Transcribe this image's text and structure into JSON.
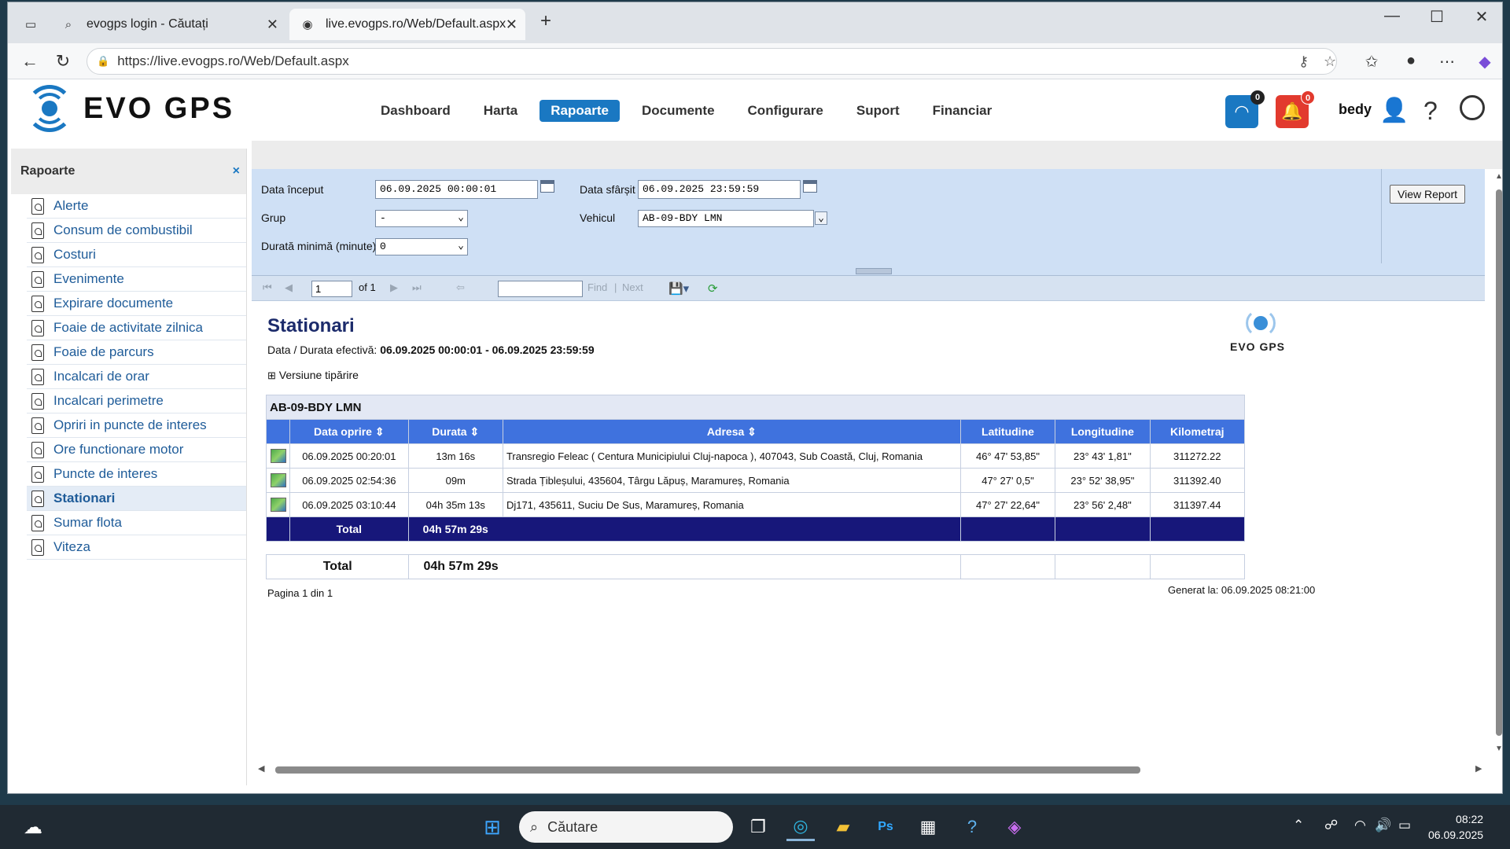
{
  "browser": {
    "tabs": [
      {
        "title": "evogps login - Căutați",
        "icon": "search-icon"
      },
      {
        "title": "live.evogps.ro/Web/Default.aspx",
        "icon": "evogps-favicon"
      }
    ],
    "url": "https://live.evogps.ro/Web/Default.aspx"
  },
  "app": {
    "logo_text": "EVO GPS",
    "menu": [
      "Dashboard",
      "Harta",
      "Rapoarte",
      "Documente",
      "Configurare",
      "Suport",
      "Financiar"
    ],
    "active_menu": "Rapoarte",
    "feed_badge": "0",
    "alert_badge": "0",
    "user": "bedy",
    "help_label": "?"
  },
  "sidebar": {
    "title": "Rapoarte",
    "close_label": "×",
    "items": [
      "Alerte",
      "Consum de combustibil",
      "Costuri",
      "Evenimente",
      "Expirare documente",
      "Foaie de activitate zilnica",
      "Foaie de parcurs",
      "Incalcari de orar",
      "Incalcari perimetre",
      "Opriri in puncte de interes",
      "Ore functionare motor",
      "Puncte de interes",
      "Stationari",
      "Sumar flota",
      "Viteza"
    ],
    "active_item": "Stationari"
  },
  "params": {
    "start_label": "Data început",
    "start_value": "06.09.2025 00:00:01",
    "end_label": "Data sfârșit",
    "end_value": "06.09.2025 23:59:59",
    "group_label": "Grup",
    "group_value": "-",
    "vehicle_label": "Vehicul",
    "vehicle_value": "AB-09-BDY LMN",
    "min_duration_label": "Durată minimă (minute)",
    "min_duration_value": "0",
    "view_report": "View Report"
  },
  "toolbar": {
    "page_value": "1",
    "of_label": "of 1",
    "find_label": "Find",
    "separator": "|",
    "next_label": "Next"
  },
  "report": {
    "title": "Stationari",
    "period_label": "Data / Durata efectivă:",
    "period_value": "06.09.2025 00:00:01 - 06.09.2025 23:59:59",
    "print_version": "Versiune tipărire",
    "vehicle": "AB-09-BDY LMN",
    "columns": [
      "Data oprire",
      "Durata",
      "Adresa",
      "Latitudine",
      "Longitudine",
      "Kilometraj"
    ],
    "rows": [
      {
        "date": "06.09.2025 00:20:01",
        "duration": "13m 16s",
        "address": "Transregio Feleac ( Centura Municipiului Cluj-napoca ),  407043, Sub Coastă, Cluj, Romania",
        "lat": "46° 47' 53,85\"",
        "lon": "23° 43' 1,81\"",
        "km": "311272.22"
      },
      {
        "date": "06.09.2025 02:54:36",
        "duration": "09m",
        "address": "Strada Țibleșului,  435604, Târgu Lăpuș, Maramureș, Romania",
        "lat": "47° 27' 0,5\"",
        "lon": "23° 52' 38,95\"",
        "km": "311392.40"
      },
      {
        "date": "06.09.2025 03:10:44",
        "duration": "04h 35m 13s",
        "address": "Dj171,  435611, Suciu De Sus, Maramureș, Romania",
        "lat": "47° 27' 22,64\"",
        "lon": "23° 56' 2,48\"",
        "km": "311397.44"
      }
    ],
    "total_label": "Total",
    "total_value": "04h 57m 29s",
    "grand_total_label": "Total",
    "grand_total_value": "04h 57m 29s",
    "page_info": "Pagina 1 din 1",
    "generated": "Generat la: 06.09.2025 08:21:00"
  },
  "taskbar": {
    "search_placeholder": "Căutare",
    "time": "08:22",
    "date": "06.09.2025"
  },
  "colors": {
    "brand_blue": "#1a78c2",
    "header_blue": "#3f72de",
    "total_navy": "#17177a",
    "params_bg": "#cfe0f5"
  }
}
